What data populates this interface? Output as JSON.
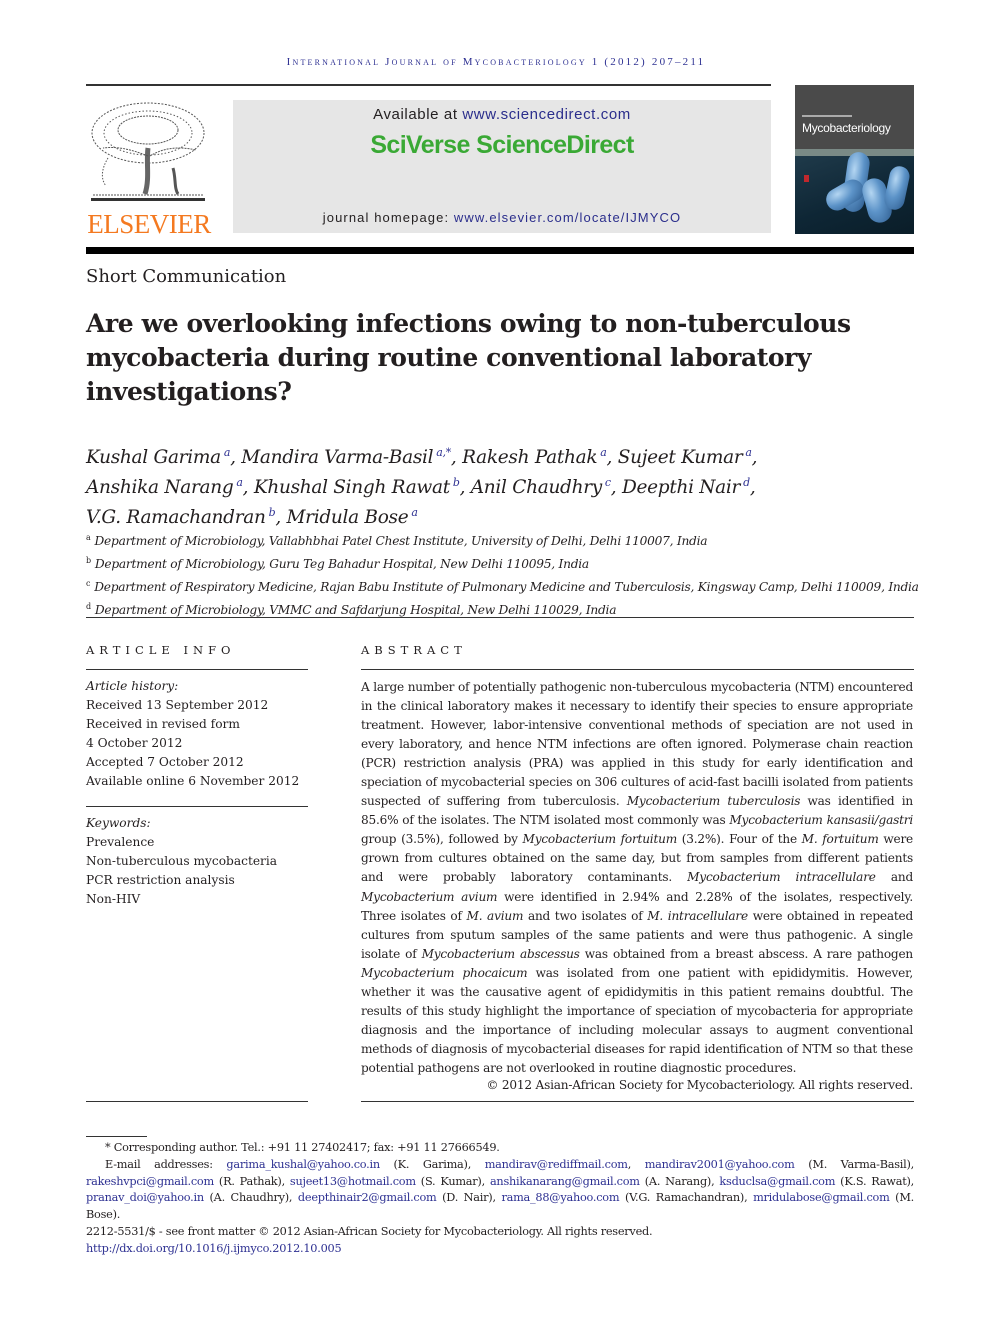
{
  "header": {
    "running_head": "International Journal of Mycobacteriology 1 (2012) 207–211",
    "publisher_logo_text": "ELSEVIER",
    "available_at_prefix": "Available at ",
    "available_at_link": "www.sciencedirect.com",
    "platform_brand": "SciVerse ScienceDirect",
    "homepage_prefix": "journal homepage: ",
    "homepage_link": "www.elsevier.com/locate/IJMYCO",
    "cover_title": "Mycobacteriology",
    "colors": {
      "elsevier_orange": "#f47920",
      "sciencedirect_green": "#3aa935",
      "link_blue": "#2e3192",
      "header_box_gray": "#e6e6e6"
    }
  },
  "article": {
    "type": "Short Communication",
    "title": "Are we overlooking infections owing to non-tuberculous mycobacteria during routine conventional laboratory investigations?",
    "authors": [
      {
        "name": "Kushal Garima",
        "aff": "a",
        "sep": ", "
      },
      {
        "name": "Mandira Varma-Basil",
        "aff": "a,*",
        "sep": ", "
      },
      {
        "name": "Rakesh Pathak",
        "aff": "a",
        "sep": ", "
      },
      {
        "name": "Sujeet Kumar",
        "aff": "a",
        "sep": ","
      },
      {
        "name": "Anshika Narang",
        "aff": "a",
        "sep": ", "
      },
      {
        "name": "Khushal Singh Rawat",
        "aff": "b",
        "sep": ", "
      },
      {
        "name": "Anil Chaudhry",
        "aff": "c",
        "sep": ", "
      },
      {
        "name": "Deepthi Nair",
        "aff": "d",
        "sep": ","
      },
      {
        "name": "V.G. Ramachandran",
        "aff": "b",
        "sep": ", "
      },
      {
        "name": "Mridula Bose",
        "aff": "a",
        "sep": ""
      }
    ],
    "affiliations": [
      {
        "key": "a",
        "text": "Department of Microbiology, Vallabhbhai Patel Chest Institute, University of Delhi, Delhi 110007, India"
      },
      {
        "key": "b",
        "text": "Department of Microbiology, Guru Teg Bahadur Hospital, New Delhi 110095, India"
      },
      {
        "key": "c",
        "text": "Department of Respiratory Medicine, Rajan Babu Institute of Pulmonary Medicine and Tuberculosis, Kingsway Camp, Delhi 110009, India"
      },
      {
        "key": "d",
        "text": "Department of Microbiology, VMMC and Safdarjung Hospital, New Delhi 110029, India"
      }
    ]
  },
  "article_info": {
    "heading": "ARTICLE INFO",
    "history_label": "Article history:",
    "history": [
      "Received 13 September 2012",
      "Received in revised form",
      "4 October 2012",
      "Accepted 7 October 2012",
      "Available online 6 November 2012"
    ],
    "keywords_label": "Keywords:",
    "keywords": [
      "Prevalence",
      "Non-tuberculous mycobacteria",
      "PCR restriction analysis",
      "Non-HIV"
    ]
  },
  "abstract": {
    "heading": "ABSTRACT",
    "segments": [
      {
        "t": "A large number of potentially pathogenic non-tuberculous mycobacteria (NTM) encountered in the clinical laboratory makes it necessary to identify their species to ensure appropriate treatment. However, labor-intensive conventional methods of speciation are not used in every laboratory, and hence NTM infections are often ignored. Polymerase chain reaction (PCR) restriction analysis (PRA) was applied in this study for early identification and speciation of mycobacterial species on 306 cultures of acid-fast bacilli isolated from patients suspected of suffering from tuberculosis. ",
        "i": false
      },
      {
        "t": "Mycobacterium tuberculosis",
        "i": true
      },
      {
        "t": " was identified in 85.6% of the isolates. The NTM isolated most commonly was ",
        "i": false
      },
      {
        "t": "Mycobacterium kansasii/gastri",
        "i": true
      },
      {
        "t": " group (3.5%), followed by ",
        "i": false
      },
      {
        "t": "Mycobacterium fortuitum",
        "i": true
      },
      {
        "t": " (3.2%). Four of the ",
        "i": false
      },
      {
        "t": "M. fortuitum",
        "i": true
      },
      {
        "t": " were grown from cultures obtained on the same day, but from samples from different patients and were probably laboratory contaminants. ",
        "i": false
      },
      {
        "t": "Mycobacterium intracellulare",
        "i": true
      },
      {
        "t": " and ",
        "i": false
      },
      {
        "t": "Mycobacterium avium",
        "i": true
      },
      {
        "t": " were identified in 2.94% and 2.28% of the isolates, respectively. Three isolates of ",
        "i": false
      },
      {
        "t": "M. avium",
        "i": true
      },
      {
        "t": " and two isolates of ",
        "i": false
      },
      {
        "t": "M. intracellulare",
        "i": true
      },
      {
        "t": " were obtained in repeated cultures from sputum samples of the same patients and were thus pathogenic. A single isolate of ",
        "i": false
      },
      {
        "t": "Mycobacterium abscessus",
        "i": true
      },
      {
        "t": " was obtained from a breast abscess. A rare pathogen ",
        "i": false
      },
      {
        "t": "Mycobacterium phocaicum",
        "i": true
      },
      {
        "t": " was isolated from one patient with epididymitis. However, whether it was the causative agent of epididymitis in this patient remains doubtful. The results of this study highlight the importance of speciation of mycobacteria for appropriate diagnosis and the importance of including molecular assays to augment conventional methods of diagnosis of mycobacterial diseases for rapid identification of NTM so that these potential pathogens are not overlooked in routine diagnostic procedures.",
        "i": false
      }
    ],
    "copyright": "© 2012 Asian-African Society for Mycobacteriology. All rights reserved."
  },
  "footnotes": {
    "corresponding": "* Corresponding author. Tel.: +91 11 27402417; fax: +91 11 27666549.",
    "emails_label": "E-mail addresses: ",
    "emails": [
      {
        "addr": "garima_kushal@yahoo.co.in",
        "after": " (K. Garima), "
      },
      {
        "addr": "mandirav@rediffmail.com",
        "after": ", "
      },
      {
        "addr": "mandirav2001@yahoo.com",
        "after": " (M. Varma-Basil), "
      },
      {
        "addr": "rakeshvpci@gmail.com",
        "after": " (R. Pathak), "
      },
      {
        "addr": "sujeet13@hotmail.com",
        "after": " (S. Kumar), "
      },
      {
        "addr": "anshikanarang@gmail.com",
        "after": " (A. Narang), "
      },
      {
        "addr": "ksduclsa@gmail.com",
        "after": " (K.S. Rawat), "
      },
      {
        "addr": "pranav_doi@yahoo.in",
        "after": " (A. Chaudhry), "
      },
      {
        "addr": "deepthinair2@gmail.com",
        "after": " (D. Nair), "
      },
      {
        "addr": "rama_88@yahoo.com",
        "after": " (V.G. Ramachandran), "
      },
      {
        "addr": "mridulabose@gmail.com",
        "after": " (M. Bose)."
      }
    ],
    "front_matter": "2212-5531/$ - see front matter © 2012 Asian-African Society for Mycobacteriology. All rights reserved.",
    "doi": "http://dx.doi.org/10.1016/j.ijmyco.2012.10.005"
  }
}
